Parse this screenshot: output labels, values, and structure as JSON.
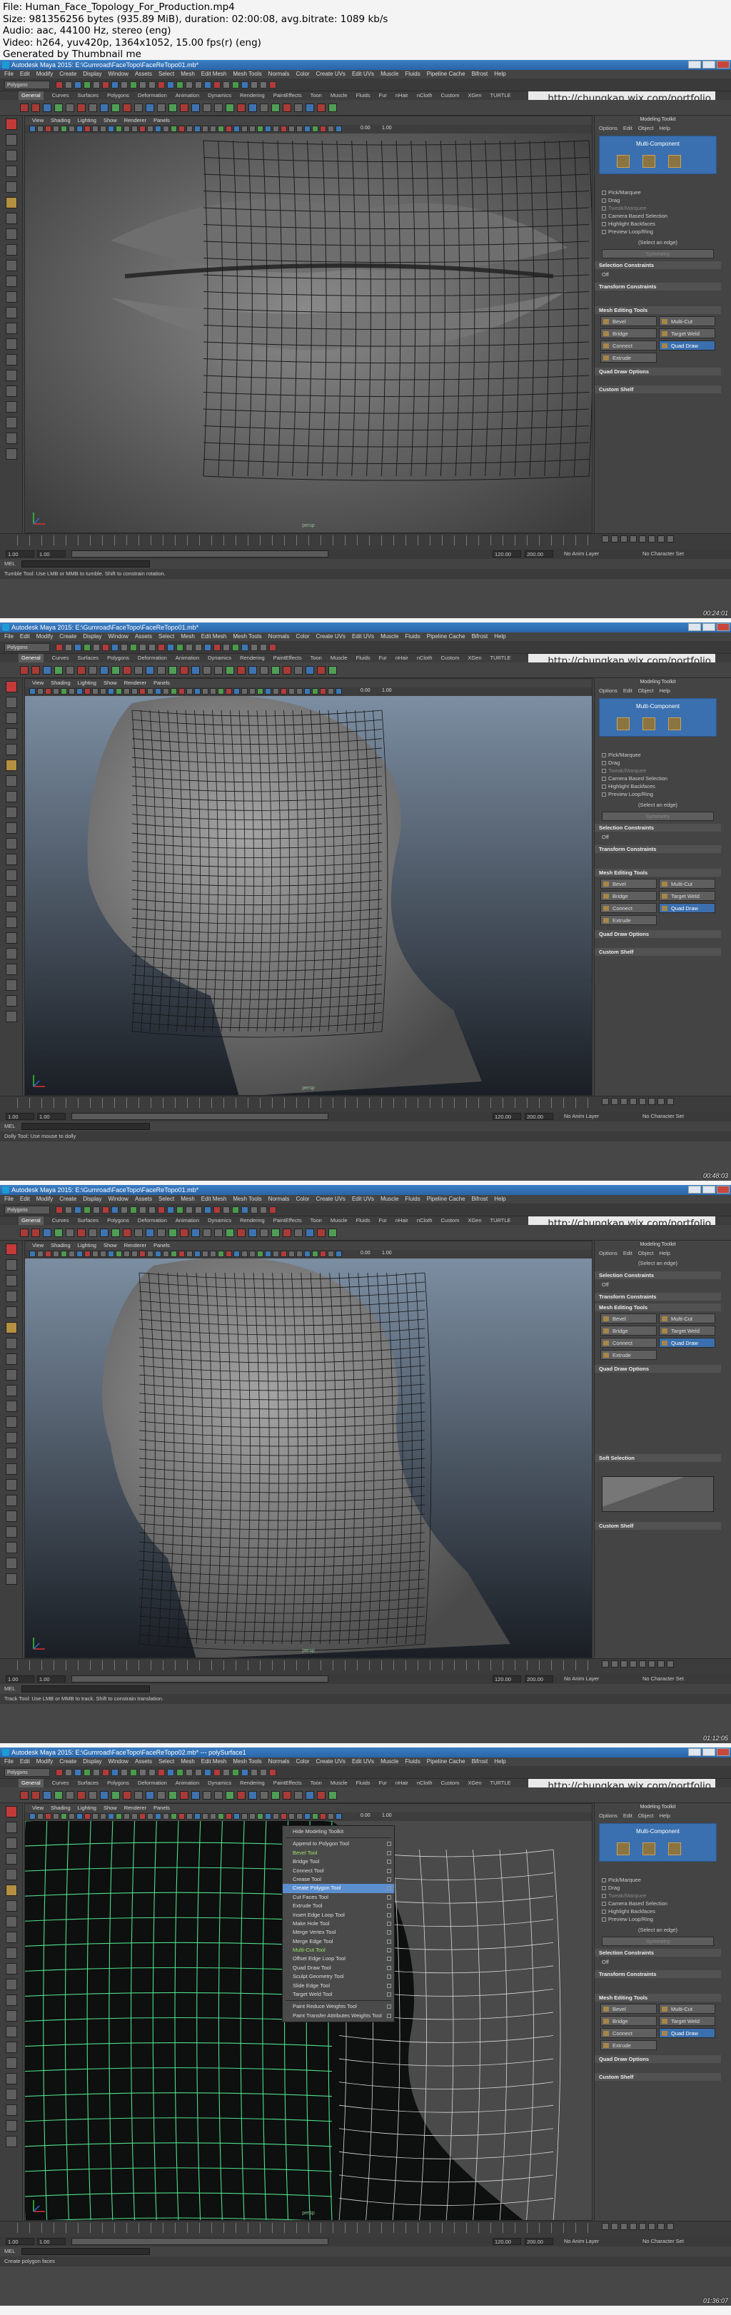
{
  "header": {
    "lines": [
      "File: Human_Face_Topology_For_Production.mp4",
      "Size: 981356256 bytes (935.89 MiB), duration: 02:00:08, avg.bitrate: 1089 kb/s",
      "Audio: aac, 44100 Hz, stereo (eng)",
      "Video: h264, yuv420p, 1364x1052, 15.00 fps(r) (eng)",
      "Generated by Thumbnail me"
    ]
  },
  "app": {
    "menus": [
      "File",
      "Edit",
      "Modify",
      "Create",
      "Display",
      "Window",
      "Assets",
      "Select",
      "Mesh",
      "Edit Mesh",
      "Mesh Tools",
      "Normals",
      "Color",
      "Create UVs",
      "Edit UVs",
      "Muscle",
      "Fluids",
      "Pipeline Cache",
      "Bifrost",
      "Help"
    ],
    "mode_selector": "Polygons",
    "shelf_tabs": [
      "General",
      "Curves",
      "Surfaces",
      "Polygons",
      "Deformation",
      "Animation",
      "Dynamics",
      "Rendering",
      "PaintEffects",
      "Toon",
      "Muscle",
      "Fluids",
      "Fur",
      "nHair",
      "nCloth",
      "Custom",
      "XGen",
      "TURTLE"
    ],
    "url_overlay": "http://chungkan.wix.com/portfolio",
    "viewport_menus": [
      "View",
      "Shading",
      "Lighting",
      "Show",
      "Renderer",
      "Panels"
    ],
    "viewport_fields": [
      "0.00",
      "1.00"
    ],
    "camera_label": "persp",
    "panel": {
      "title": "Modeling Toolkit",
      "options": [
        "Options",
        "Edit",
        "Object",
        "Help"
      ],
      "multi_label": "Multi-Component",
      "pick_options": [
        "Pick/Marquee",
        "Drag",
        "Tweak/Marquee",
        "Camera Based Selection",
        "Highlight Backfaces",
        "Preview Loop/Ring"
      ],
      "select_edge": "(Select an edge)",
      "symmetry": "Symmetry",
      "constraints_header": "Selection Constraints",
      "constraint_value": "Off",
      "transform_header": "Transform Constraints",
      "editing_header": "Mesh Editing Tools",
      "tools": [
        "Bevel",
        "Multi-Cut",
        "Bridge",
        "Target Weld",
        "Connect",
        "Quad Draw",
        "Extrude"
      ],
      "quad_header": "Quad Draw Options",
      "shelf_header": "Custom Shelf",
      "soft_header": "Soft Selection"
    },
    "range": {
      "start": "1.00",
      "current": "1.00",
      "end_a": "120.00",
      "end_b": "200.00",
      "anim_layer": "No Anim Layer",
      "char_set": "No Character Set"
    },
    "mel_label": "MEL"
  },
  "frames": [
    {
      "title": "Autodesk Maya 2015: E:\\Gumroad\\FaceTopo\\FaceReTopo01.mb*",
      "timestamp": "00:24:01",
      "help": "Tumble Tool: Use LMB or MMB to tumble. Shift to constrain rotation."
    },
    {
      "title": "Autodesk Maya 2015: E:\\Gumroad\\FaceTopo\\FaceReTopo01.mb*",
      "timestamp": "00:48:03",
      "help": "Dolly Tool: Use mouse to dolly"
    },
    {
      "title": "Autodesk Maya 2015: E:\\Gumroad\\FaceTopo\\FaceReTopo01.mb*",
      "timestamp": "01:12:05",
      "help": "Track Tool: Use LMB or MMB to track. Shift to constrain translation."
    },
    {
      "title": "Autodesk Maya 2015: E:\\Gumroad\\FaceTopo\\FaceReTopo02.mb* --- polySurface1",
      "timestamp": "01:36:07",
      "help": "Create polygon faces"
    }
  ],
  "mesh_tools_menu": [
    "Hide Modeling Toolkit",
    "Append to Polygon Tool",
    "Bevel Tool",
    "Bridge Tool",
    "Connect Tool",
    "Crease Tool",
    "Create Polygon Tool",
    "Cut Faces Tool",
    "Extrude Tool",
    "Insert Edge Loop Tool",
    "Make Hole Tool",
    "Merge Vertex Tool",
    "Merge Edge Tool",
    "Multi-Cut Tool",
    "Offset Edge Loop Tool",
    "Quad Draw Tool",
    "Sculpt Geometry Tool",
    "Slide Edge Tool",
    "Target Weld Tool",
    "Paint Reduce Weights Tool",
    "Paint Transfer Attributes Weights Tool"
  ],
  "colors": {
    "ui_bg": "#444444",
    "title_blue": "#2a64a8",
    "highlight_blue": "#3b6fae",
    "wire_green": "#4fe08a"
  }
}
